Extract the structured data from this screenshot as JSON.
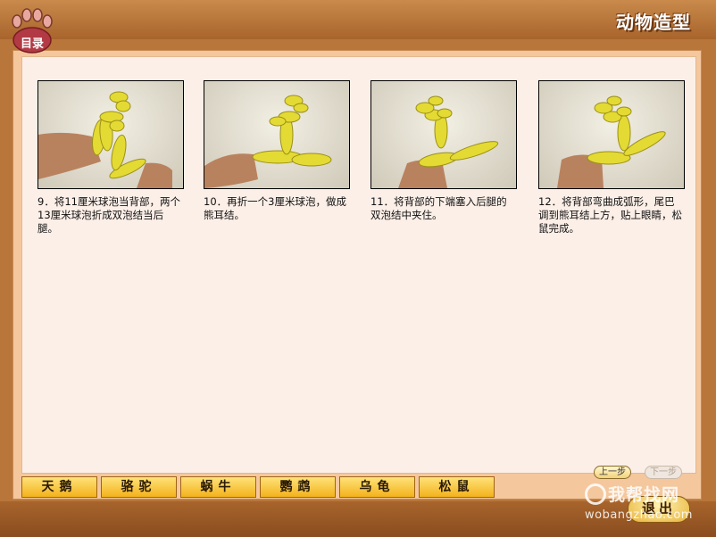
{
  "header": {
    "toc_label": "目录",
    "title": "动物造型"
  },
  "steps": [
    {
      "text": "9．将11厘米球泡当背部，两个13厘米球泡折成双泡结当后腿。"
    },
    {
      "text": "10．再折一个3厘米球泡，做成熊耳结。"
    },
    {
      "text": "11．将背部的下端塞入后腿的双泡结中夹住。"
    },
    {
      "text": "12．将背部弯曲成弧形，尾巴调到熊耳结上方，贴上眼睛，松鼠完成。"
    }
  ],
  "tabs": [
    "天鹅",
    "骆驼",
    "蜗牛",
    "鹦鹉",
    "乌龟",
    "松鼠"
  ],
  "nav": {
    "prev": "上一步",
    "next": "下一步",
    "exit": "退出"
  },
  "watermark": {
    "name": "我帮找网",
    "url": "wobangzhao.com"
  },
  "colors": {
    "balloon": "#e8e03c",
    "frame": "#b8763a",
    "panel": "#fcefe8",
    "tab": "#f3b21c"
  }
}
